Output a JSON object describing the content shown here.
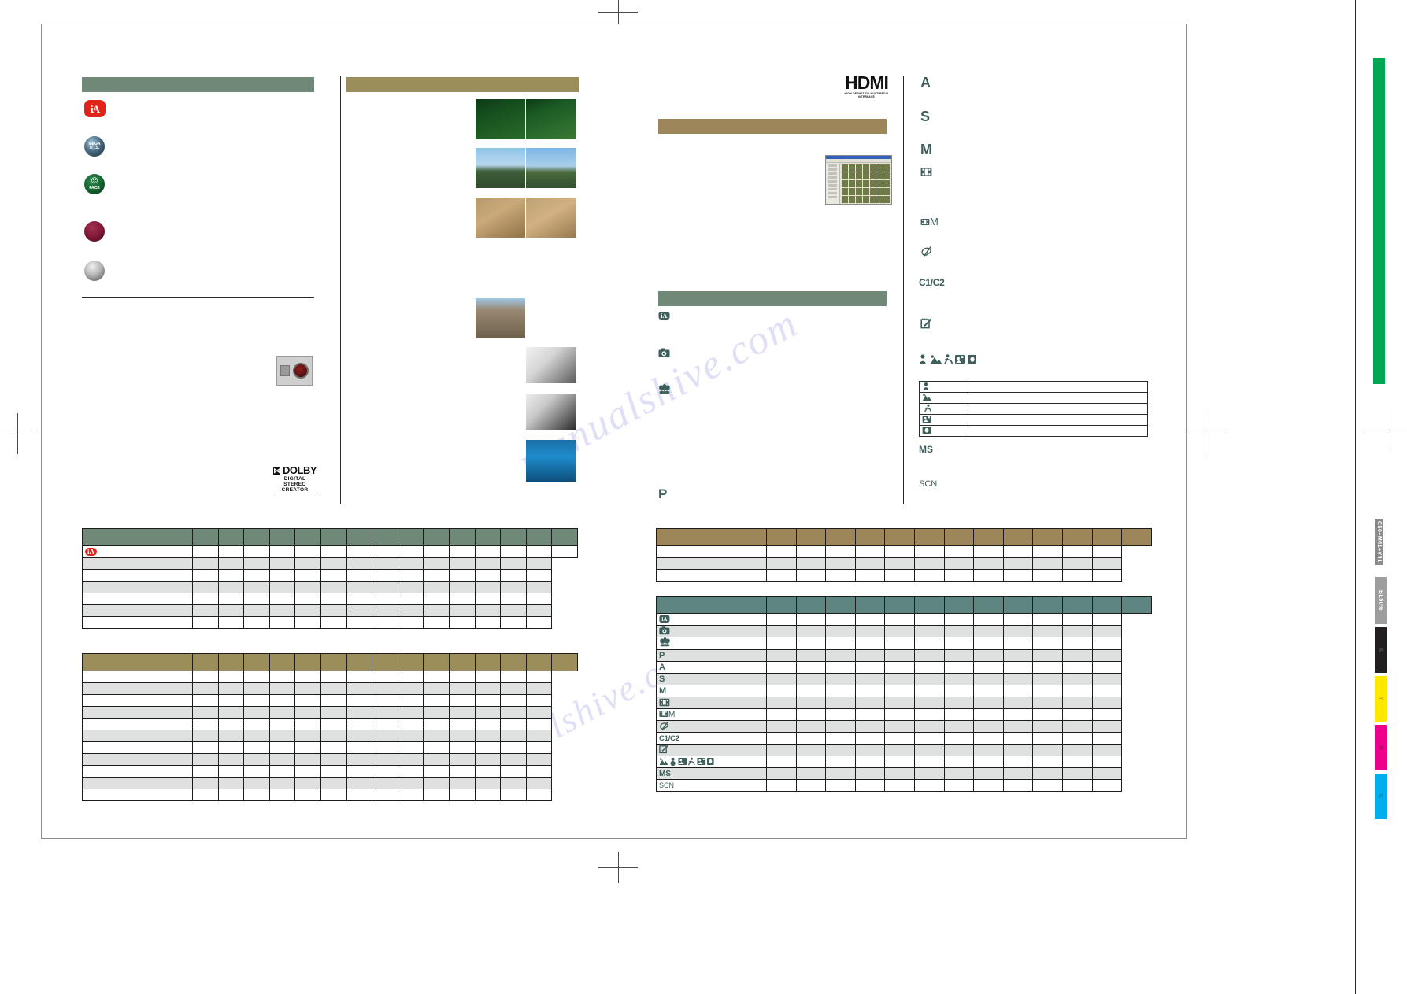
{
  "document": {
    "type": "print-proof-page",
    "page_code": "C50+M41+Y41",
    "screen_code": "BL50%",
    "colors": {
      "teal_bar": "#6f8878",
      "olive_bar": "#9b8e5a",
      "tan_bar": "#9d8659",
      "teal_table": "#5e8580",
      "row_shade": "#dfe1e1",
      "ia_red": "#e2231a",
      "glyph": "#3f5f5c",
      "spot_green": "#00a651"
    },
    "watermark": "manualshive.com"
  },
  "left_column": {
    "section_bar_label": "",
    "badges": [
      {
        "name": "ia-intelligent-auto",
        "label": "iA"
      },
      {
        "name": "mega-ois",
        "label": "MEGA O.I.S."
      },
      {
        "name": "face-detection",
        "label": "FACE"
      },
      {
        "name": "red-seal",
        "label": ""
      },
      {
        "name": "silver-seal",
        "label": ""
      }
    ],
    "camera_back_illustration": {
      "name": "camera-rear-dial"
    },
    "dolby_logo": {
      "mark": "DOLBY",
      "box": "⧫",
      "line1": "DIGITAL",
      "line2": "STEREO CREATOR"
    }
  },
  "middle_column": {
    "section_bar_label": "",
    "comparison_pairs": [
      {
        "name": "parrot-comparison",
        "left": "parrot-left",
        "right": "parrot-right"
      },
      {
        "name": "landscape-comparison",
        "left": "landscape-left",
        "right": "landscape-right"
      },
      {
        "name": "coins-comparison",
        "left": "coins-left",
        "right": "coins-right"
      },
      {
        "name": "rock-comparison",
        "left": "rock-left",
        "right": "rock-right"
      }
    ],
    "accessories": [
      {
        "name": "external-flash-photo"
      },
      {
        "name": "conversion-lens-photo"
      },
      {
        "name": "underwater-diving-photo"
      }
    ]
  },
  "right_column": {
    "hdmi_logo": {
      "big": "HDMI",
      "sub": "HIGH-DEFINITION MULTIMEDIA INTERFACE"
    },
    "tan_bar_label": "",
    "pc_screenshot": {
      "name": "photofunstudio-window"
    },
    "teal_bar_label": "",
    "mode_items": [
      {
        "name": "mode-intelligent-auto",
        "glyph": "iA"
      },
      {
        "name": "mode-normal-picture",
        "glyph": "camera"
      },
      {
        "name": "mode-macro",
        "glyph": "flower"
      },
      {
        "name": "mode-program-ae",
        "glyph": "P"
      }
    ]
  },
  "far_right_column": {
    "mode_dial_items": [
      {
        "name": "mode-aperture-priority",
        "glyph": "A"
      },
      {
        "name": "mode-shutter-priority",
        "glyph": "S"
      },
      {
        "name": "mode-manual",
        "glyph": "M"
      },
      {
        "name": "mode-motion-picture",
        "glyph": "film"
      },
      {
        "name": "mode-creative-movie",
        "glyph": "filmM"
      },
      {
        "name": "mode-my-colour",
        "glyph": "palette"
      },
      {
        "name": "mode-custom",
        "glyph": "C1/C2"
      },
      {
        "name": "mode-clipboard",
        "glyph": "clipboard"
      },
      {
        "name": "mode-scene-row",
        "glyph": "scene-icons"
      },
      {
        "name": "mode-multi-aspect",
        "glyph": "MS"
      },
      {
        "name": "mode-scene",
        "glyph": "SCN"
      }
    ],
    "scene_table": {
      "rows": [
        {
          "icon": "portrait-icon",
          "text": ""
        },
        {
          "icon": "scenery-icon",
          "text": ""
        },
        {
          "icon": "sports-icon",
          "text": ""
        },
        {
          "icon": "night-portrait-icon",
          "text": ""
        },
        {
          "icon": "close-up-icon",
          "text": ""
        }
      ]
    }
  },
  "tables": {
    "left_top": {
      "name": "recording-mode-table-1",
      "header_color": "teal",
      "columns": 16,
      "headers": [
        "",
        "",
        "",
        "",
        "",
        "",
        "",
        "",
        "",
        "",
        "",
        "",
        "",
        "",
        "",
        ""
      ],
      "rows": [
        {
          "label": "iA",
          "label_icon": "ia-badge",
          "cells": [
            "",
            "",
            "",
            "",
            "",
            "",
            "",
            "",
            "",
            "",
            "",
            "",
            "",
            "",
            ""
          ]
        },
        {
          "label": "",
          "cells": [
            "",
            "",
            "",
            "",
            "",
            "",
            "",
            "",
            "",
            "",
            "",
            "",
            "",
            "",
            ""
          ]
        },
        {
          "label": "",
          "cells": [
            "",
            "",
            "",
            "",
            "",
            "",
            "",
            "",
            "",
            "",
            "",
            "",
            "",
            "",
            ""
          ]
        },
        {
          "label": "",
          "cells": [
            "",
            "",
            "",
            "",
            "",
            "",
            "",
            "",
            "",
            "",
            "",
            "",
            "",
            "",
            ""
          ]
        },
        {
          "label": "",
          "cells": [
            "",
            "",
            "",
            "",
            "",
            "",
            "",
            "",
            "",
            "",
            "",
            "",
            "",
            "",
            ""
          ]
        },
        {
          "label": "",
          "cells": [
            "",
            "",
            "",
            "",
            "",
            "",
            "",
            "",
            "",
            "",
            "",
            "",
            "",
            "",
            ""
          ]
        },
        {
          "label": "",
          "cells": [
            "",
            "",
            "",
            "",
            "",
            "",
            "",
            "",
            "",
            "",
            "",
            "",
            "",
            "",
            ""
          ]
        }
      ]
    },
    "left_bottom": {
      "name": "recording-mode-table-2",
      "header_color": "olive",
      "columns": 16,
      "rows": [
        {
          "label": "",
          "cells": [
            "",
            "",
            "",
            "",
            "",
            "",
            "",
            "",
            "",
            "",
            "",
            "",
            "",
            "",
            ""
          ]
        },
        {
          "label": "",
          "cells": [
            "",
            "",
            "",
            "",
            "",
            "",
            "",
            "",
            "",
            "",
            "",
            "",
            "",
            "",
            ""
          ]
        },
        {
          "label": "",
          "cells": [
            "",
            "",
            "",
            "",
            "",
            "",
            "",
            "",
            "",
            "",
            "",
            "",
            "",
            "",
            ""
          ]
        },
        {
          "label": "",
          "cells": [
            "",
            "",
            "",
            "",
            "",
            "",
            "",
            "",
            "",
            "",
            "",
            "",
            "",
            "",
            ""
          ]
        },
        {
          "label": "",
          "cells": [
            "",
            "",
            "",
            "",
            "",
            "",
            "",
            "",
            "",
            "",
            "",
            "",
            "",
            "",
            ""
          ]
        },
        {
          "label": "",
          "cells": [
            "",
            "",
            "",
            "",
            "",
            "",
            "",
            "",
            "",
            "",
            "",
            "",
            "",
            "",
            ""
          ]
        },
        {
          "label": "",
          "cells": [
            "",
            "",
            "",
            "",
            "",
            "",
            "",
            "",
            "",
            "",
            "",
            "",
            "",
            "",
            ""
          ]
        },
        {
          "label": "",
          "cells": [
            "",
            "",
            "",
            "",
            "",
            "",
            "",
            "",
            "",
            "",
            "",
            "",
            "",
            "",
            ""
          ]
        },
        {
          "label": "",
          "cells": [
            "",
            "",
            "",
            "",
            "",
            "",
            "",
            "",
            "",
            "",
            "",
            "",
            "",
            "",
            ""
          ]
        },
        {
          "label": "",
          "cells": [
            "",
            "",
            "",
            "",
            "",
            "",
            "",
            "",
            "",
            "",
            "",
            "",
            "",
            "",
            ""
          ]
        },
        {
          "label": "",
          "cells": [
            "",
            "",
            "",
            "",
            "",
            "",
            "",
            "",
            "",
            "",
            "",
            "",
            "",
            "",
            ""
          ]
        }
      ]
    },
    "right_top": {
      "name": "playback-mode-table",
      "header_color": "tan",
      "columns": 14,
      "rows": [
        {
          "label": "",
          "cells": [
            "",
            "",
            "",
            "",
            "",
            "",
            "",
            "",
            "",
            "",
            "",
            "",
            ""
          ]
        },
        {
          "label": "",
          "cells": [
            "",
            "",
            "",
            "",
            "",
            "",
            "",
            "",
            "",
            "",
            "",
            "",
            ""
          ]
        },
        {
          "label": "",
          "cells": [
            "",
            "",
            "",
            "",
            "",
            "",
            "",
            "",
            "",
            "",
            "",
            "",
            ""
          ]
        }
      ]
    },
    "right_bottom": {
      "name": "mode-function-matrix",
      "header_color": "teal2",
      "columns": 14,
      "rows": [
        {
          "label": "iA",
          "glyph": "ia-badge",
          "cells": [
            "",
            "",
            "",
            "",
            "",
            "",
            "",
            "",
            "",
            "",
            "",
            "",
            ""
          ]
        },
        {
          "label": "",
          "glyph": "camera-icon",
          "cells": [
            "",
            "",
            "",
            "",
            "",
            "",
            "",
            "",
            "",
            "",
            "",
            "",
            ""
          ]
        },
        {
          "label": "",
          "glyph": "flower-icon",
          "cells": [
            "",
            "",
            "",
            "",
            "",
            "",
            "",
            "",
            "",
            "",
            "",
            "",
            ""
          ]
        },
        {
          "label": "P",
          "glyph": "text",
          "cells": [
            "",
            "",
            "",
            "",
            "",
            "",
            "",
            "",
            "",
            "",
            "",
            "",
            ""
          ]
        },
        {
          "label": "A",
          "glyph": "text",
          "cells": [
            "",
            "",
            "",
            "",
            "",
            "",
            "",
            "",
            "",
            "",
            "",
            "",
            ""
          ]
        },
        {
          "label": "S",
          "glyph": "text",
          "cells": [
            "",
            "",
            "",
            "",
            "",
            "",
            "",
            "",
            "",
            "",
            "",
            "",
            ""
          ]
        },
        {
          "label": "M",
          "glyph": "text",
          "cells": [
            "",
            "",
            "",
            "",
            "",
            "",
            "",
            "",
            "",
            "",
            "",
            "",
            ""
          ]
        },
        {
          "label": "",
          "glyph": "film-icon",
          "cells": [
            "",
            "",
            "",
            "",
            "",
            "",
            "",
            "",
            "",
            "",
            "",
            "",
            ""
          ]
        },
        {
          "label": "M",
          "glyph": "film-m-icon",
          "cells": [
            "",
            "",
            "",
            "",
            "",
            "",
            "",
            "",
            "",
            "",
            "",
            "",
            ""
          ]
        },
        {
          "label": "",
          "glyph": "palette-icon",
          "cells": [
            "",
            "",
            "",
            "",
            "",
            "",
            "",
            "",
            "",
            "",
            "",
            "",
            ""
          ]
        },
        {
          "label": "C1/C2",
          "glyph": "text",
          "cells": [
            "",
            "",
            "",
            "",
            "",
            "",
            "",
            "",
            "",
            "",
            "",
            "",
            ""
          ]
        },
        {
          "label": "",
          "glyph": "clipboard-icon",
          "cells": [
            "",
            "",
            "",
            "",
            "",
            "",
            "",
            "",
            "",
            "",
            "",
            "",
            ""
          ]
        },
        {
          "label": "",
          "glyph": "scene-row-icons",
          "cells": [
            "",
            "",
            "",
            "",
            "",
            "",
            "",
            "",
            "",
            "",
            "",
            "",
            ""
          ]
        },
        {
          "label": "MS",
          "glyph": "text",
          "cells": [
            "",
            "",
            "",
            "",
            "",
            "",
            "",
            "",
            "",
            "",
            "",
            "",
            ""
          ]
        },
        {
          "label": "SCN",
          "glyph": "text",
          "cells": [
            "",
            "",
            "",
            "",
            "",
            "",
            "",
            "",
            "",
            "",
            "",
            "",
            ""
          ]
        }
      ]
    }
  },
  "print_marks": {
    "spot_bar_label": "",
    "bars": [
      {
        "name": "page-code-bar",
        "label": "C50+M41+Y41",
        "color": "#8a8a8a",
        "text_color": "#ffffff"
      },
      {
        "name": "screen-bar",
        "label": "BL50%",
        "color": "#9e9e9e",
        "text_color": "#ffffff"
      },
      {
        "name": "black-bar",
        "label": "K",
        "color": "#231f20",
        "text_color": "#555555"
      },
      {
        "name": "yellow-bar",
        "label": "Y",
        "color": "#ffe800",
        "text_color": "#c8a000"
      },
      {
        "name": "magenta-bar",
        "label": "M",
        "color": "#ec008c",
        "text_color": "#a80063"
      },
      {
        "name": "cyan-bar",
        "label": "C",
        "color": "#00aeef",
        "text_color": "#0077a3"
      }
    ]
  }
}
